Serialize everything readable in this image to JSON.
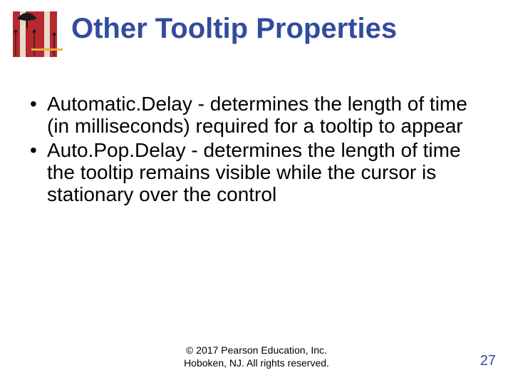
{
  "title": "Other Tooltip Properties",
  "bullets": [
    "Automatic.Delay - determines the length of time (in milliseconds) required for a tooltip to appear",
    "Auto.Pop.Delay - determines the length of time the tooltip remains visible while the cursor is stationary over the control"
  ],
  "footer_line1": "© 2017 Pearson Education, Inc.",
  "footer_line2": "Hoboken, NJ. All rights reserved.",
  "page_number": "27"
}
